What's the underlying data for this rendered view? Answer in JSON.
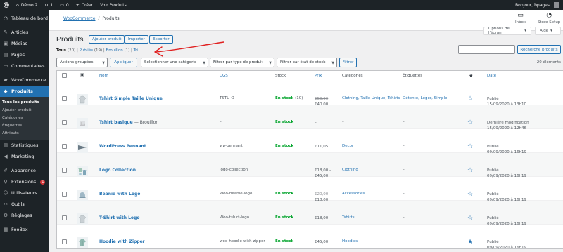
{
  "admin_bar": {
    "site_name": "Démo 2",
    "updates_count": "1",
    "comments_count": "0",
    "new_label": "Créer",
    "view_label": "Voir Produits",
    "greeting": "Bonjour, bpages"
  },
  "sidebar": {
    "items": [
      {
        "label": "Tableau de bord",
        "icon": "dashboard-icon"
      },
      {
        "label": "Articles",
        "icon": "pin-icon"
      },
      {
        "label": "Médias",
        "icon": "media-icon"
      },
      {
        "label": "Pages",
        "icon": "page-icon"
      },
      {
        "label": "Commentaires",
        "icon": "comment-icon"
      },
      {
        "label": "WooCommerce",
        "icon": "woo-icon"
      },
      {
        "label": "Produits",
        "icon": "product-icon"
      },
      {
        "label": "Statistiques",
        "icon": "chart-icon"
      },
      {
        "label": "Marketing",
        "icon": "megaphone-icon"
      },
      {
        "label": "Apparence",
        "icon": "brush-icon"
      },
      {
        "label": "Extensions",
        "icon": "plugin-icon",
        "badge": "1"
      },
      {
        "label": "Utilisateurs",
        "icon": "users-icon"
      },
      {
        "label": "Outils",
        "icon": "wrench-icon"
      },
      {
        "label": "Réglages",
        "icon": "settings-icon"
      },
      {
        "label": "FooBox",
        "icon": "box-icon"
      }
    ],
    "submenu": [
      "Tous les produits",
      "Ajouter produit",
      "Catégories",
      "Étiquettes",
      "Attributs"
    ]
  },
  "header": {
    "breadcrumb_link": "WooCommerce",
    "breadcrumb_sep": "/",
    "breadcrumb_current": "Produits",
    "inbox_label": "Inbox",
    "store_setup_label": "Store Setup"
  },
  "screen_options": "Options de l'écran",
  "help": "Aide",
  "page": {
    "title": "Produits",
    "add_button": "Ajouter produit",
    "import_button": "Importer",
    "export_button": "Exporter"
  },
  "filters": {
    "all": "Tous",
    "all_count": "(20)",
    "published": "Publiés",
    "published_count": "(19)",
    "draft": "Brouillon",
    "draft_count": "(1)",
    "sort": "Tri",
    "sep": "|",
    "bulk_actions": "Actions groupées",
    "apply": "Appliquer",
    "category": "Sélectionner une catégorie",
    "product_type": "Filtrer par type de produit",
    "stock_status": "Filtrer par état de stock",
    "filter": "Filtrer",
    "search_button": "Recherche produits",
    "item_count": "20 éléments"
  },
  "columns": {
    "name": "Nom",
    "sku": "UGS",
    "stock": "Stock",
    "price": "Prix",
    "categories": "Catégories",
    "tags": "Étiquettes",
    "featured": "★",
    "date": "Date"
  },
  "products": [
    {
      "name": "Tshirt Simple Taille Unique",
      "status": "",
      "sku": "TSTU-O",
      "stock": "En stock",
      "qty": "(10)",
      "price_old": "€50,00",
      "price": "€40,00",
      "categories": "Clothing, Taille Unique, Tshirts",
      "tags": "Détente, Léger, Simple",
      "featured": false,
      "date_status": "Publié",
      "date": "15/09/2020 à 13h10",
      "thumb": "tshirt-icon"
    },
    {
      "name": "Tshirt basique",
      "status": "— Brouillon",
      "sku": "–",
      "stock": "En stock",
      "qty": "",
      "price_old": "",
      "price": "–",
      "categories": "–",
      "tags": "–",
      "featured": false,
      "date_status": "Dernière modification",
      "date": "15/09/2020 à 12h46",
      "thumb": "placeholder-icon"
    },
    {
      "name": "WordPress Pennant",
      "status": "",
      "sku": "wp-pennant",
      "stock": "En stock",
      "qty": "",
      "price_old": "",
      "price": "€11,05",
      "categories": "Decor",
      "tags": "–",
      "featured": false,
      "date_status": "Publié",
      "date": "09/09/2020 à 16h19",
      "thumb": "pennant-icon"
    },
    {
      "name": "Logo Collection",
      "status": "",
      "sku": "logo-collection",
      "stock": "",
      "qty": "",
      "price_old": "€18,00 –",
      "price": "€45,00",
      "categories": "Clothing",
      "tags": "–",
      "featured": false,
      "date_status": "Publié",
      "date": "09/09/2020 à 16h19",
      "thumb": "clothes-icon"
    },
    {
      "name": "Beanie with Logo",
      "status": "",
      "sku": "Woo-beanie-logo",
      "stock": "En stock",
      "qty": "",
      "price_old": "€20,00",
      "price": "€18,00",
      "categories": "Accessories",
      "tags": "–",
      "featured": false,
      "date_status": "Publié",
      "date": "09/09/2020 à 16h19",
      "thumb": "beanie-icon"
    },
    {
      "name": "T-Shirt with Logo",
      "status": "",
      "sku": "Woo-tshirt-logo",
      "stock": "En stock",
      "qty": "",
      "price_old": "",
      "price": "€18,00",
      "categories": "Tshirts",
      "tags": "–",
      "featured": false,
      "date_status": "Publié",
      "date": "09/09/2020 à 16h19",
      "thumb": "tshirt-icon"
    },
    {
      "name": "Hoodie with Zipper",
      "status": "",
      "sku": "woo-hoodie-with-zipper",
      "stock": "En stock",
      "qty": "",
      "price_old": "",
      "price": "€45,00",
      "categories": "Hoodies",
      "tags": "–",
      "featured": true,
      "date_status": "Publié",
      "date": "09/09/2020 à 16h19",
      "thumb": "hoodie-icon"
    }
  ],
  "colors": {
    "admin_dark": "#1d2327",
    "accent_blue": "#2271b1",
    "in_stock_green": "#00a32a",
    "annotation_red": "#e02020"
  }
}
